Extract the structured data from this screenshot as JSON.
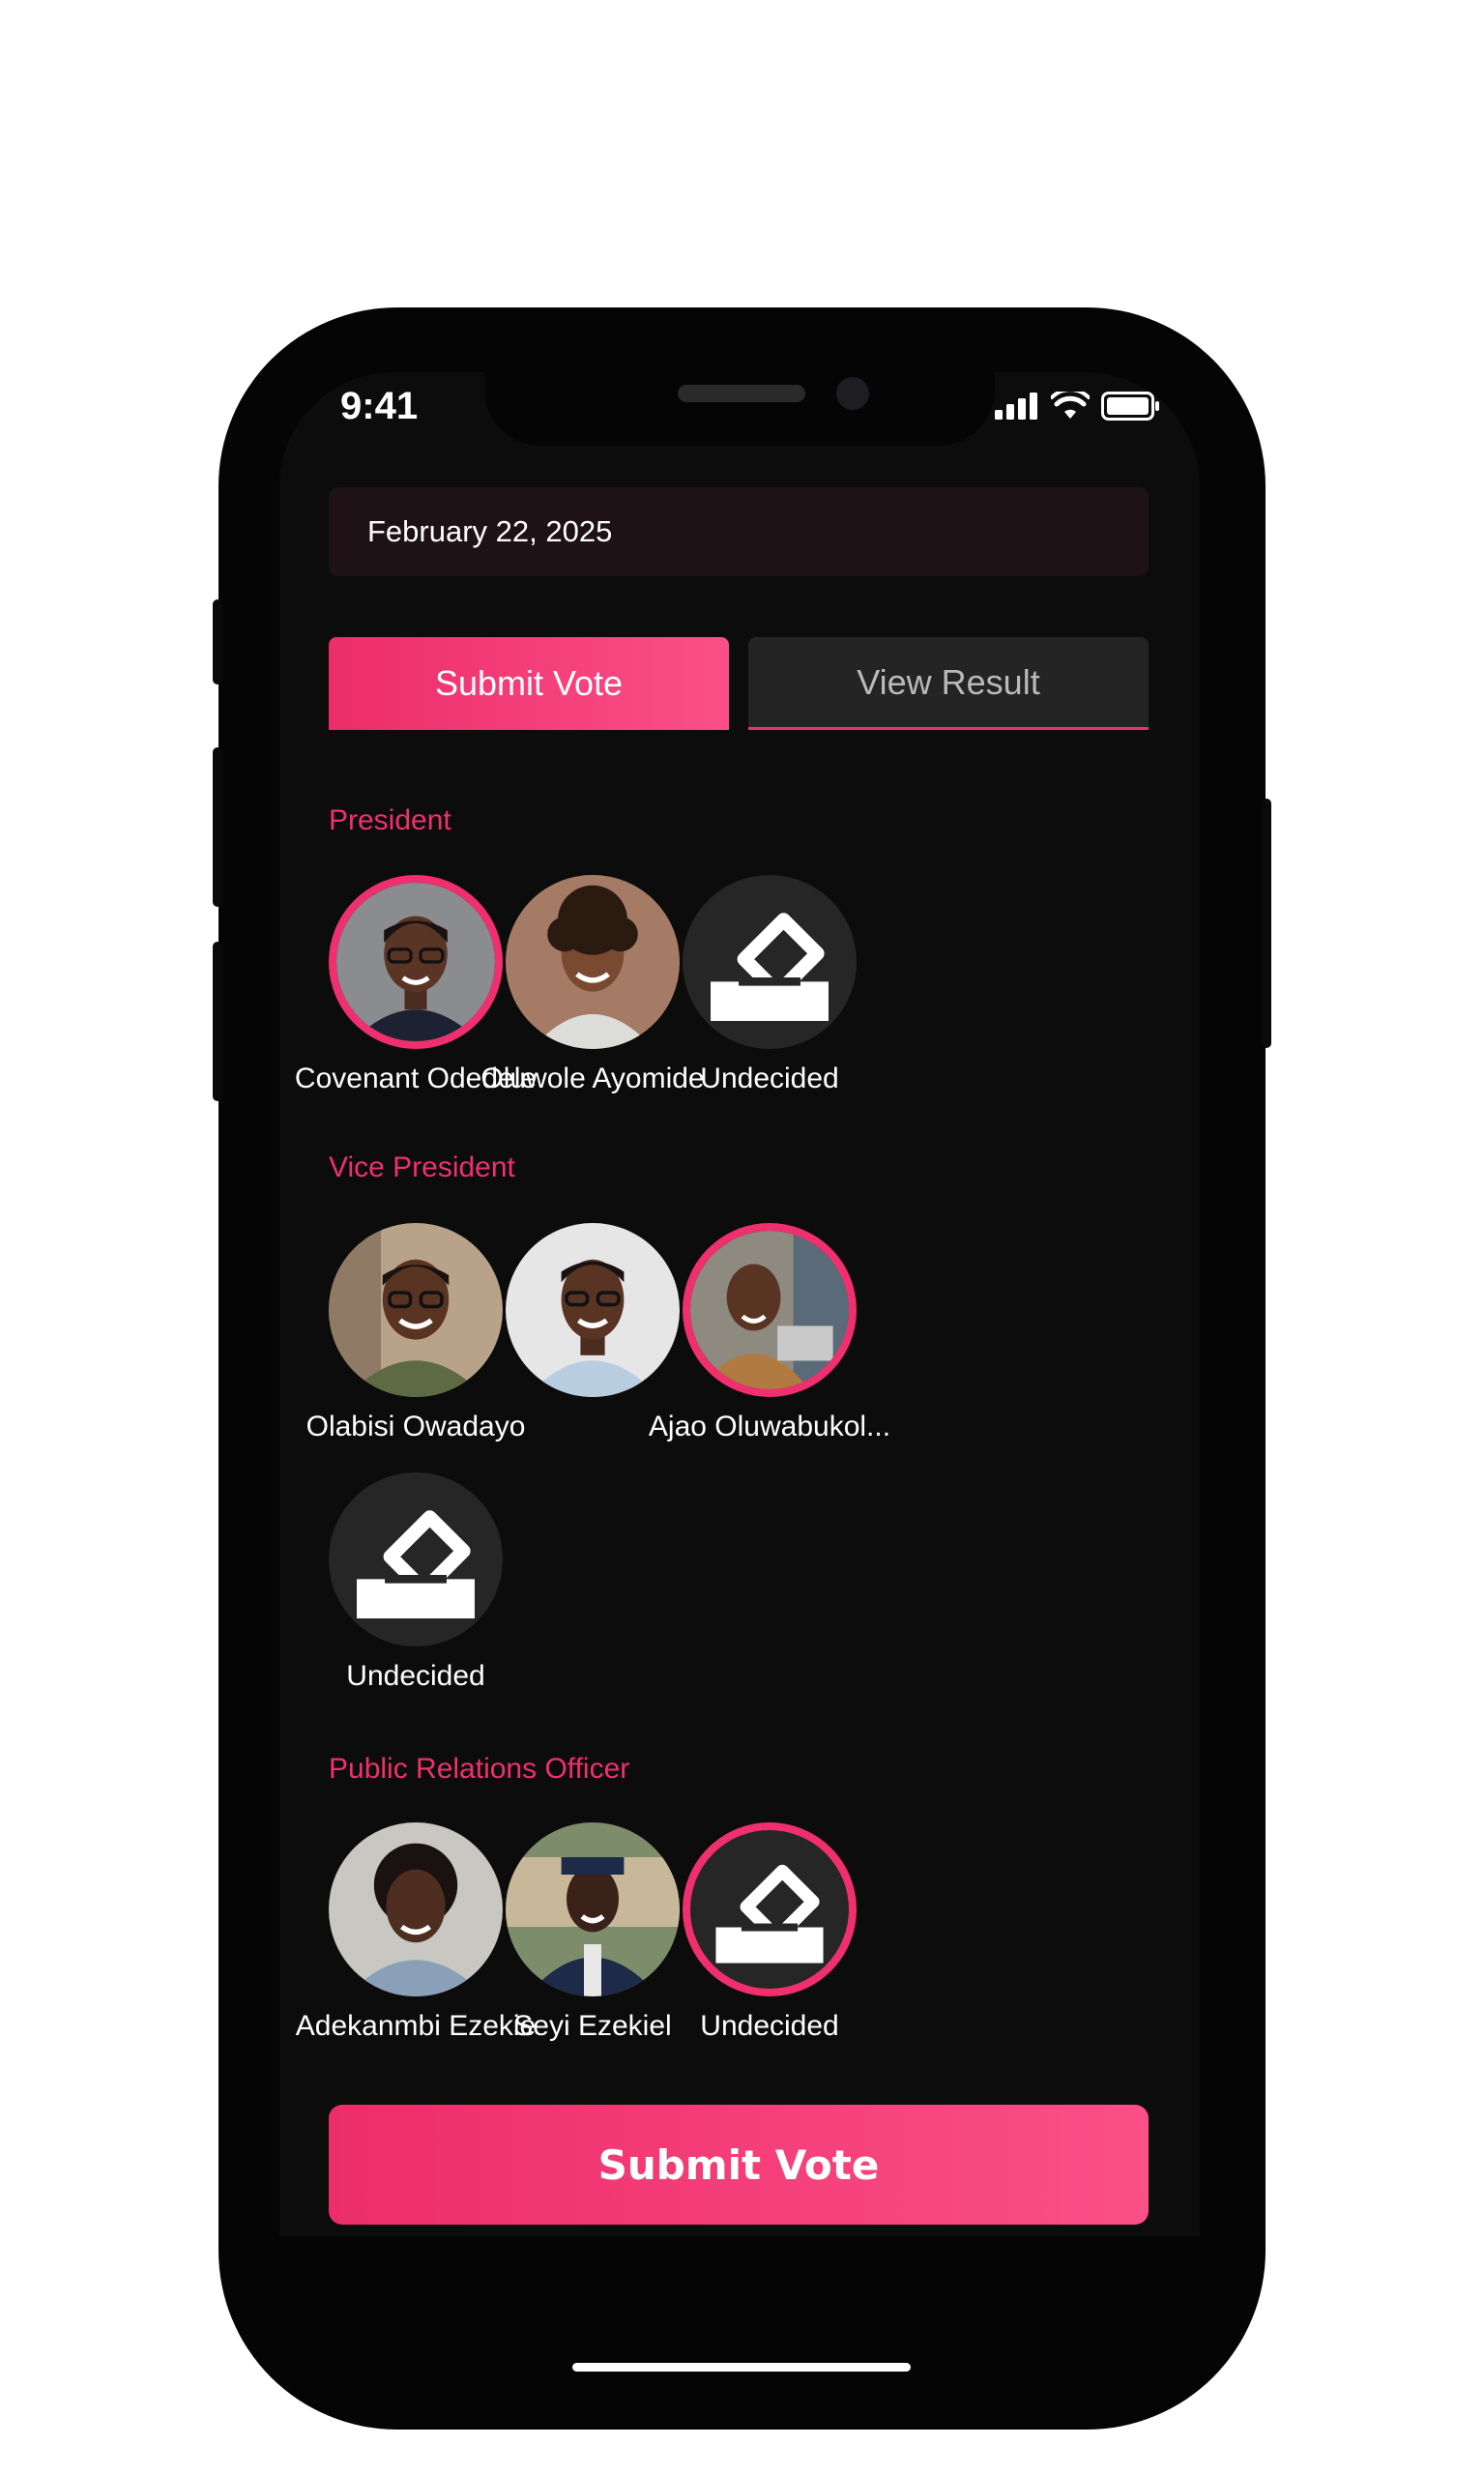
{
  "status_bar": {
    "time": "9:41"
  },
  "date_field": {
    "value": "February 22, 2025"
  },
  "tabs": [
    {
      "label": "Submit Vote",
      "active": true
    },
    {
      "label": "View Result",
      "active": false
    }
  ],
  "sections": [
    {
      "title": "President",
      "candidates": [
        {
          "name": "Covenant Odedele",
          "selected": true
        },
        {
          "name": "Oluwole Ayomide",
          "selected": false
        },
        {
          "name": "Undecided",
          "selected": false,
          "icon": "ballot-box-icon"
        }
      ]
    },
    {
      "title": "Vice President",
      "candidates": [
        {
          "name": "Olabisi Owadayo",
          "selected": false
        },
        {
          "name": "",
          "selected": false
        },
        {
          "name": "Ajao Oluwabukol...",
          "selected": true
        },
        {
          "name": "Undecided",
          "selected": false,
          "icon": "ballot-box-icon"
        }
      ]
    },
    {
      "title": "Public Relations Officer",
      "candidates": [
        {
          "name": "Adekanmbi Ezekie",
          "selected": false
        },
        {
          "name": "Seyi Ezekiel",
          "selected": false
        },
        {
          "name": "Undecided",
          "selected": true,
          "icon": "ballot-box-icon"
        }
      ]
    }
  ],
  "submit_button": {
    "label": "Submit Vote"
  },
  "colors": {
    "accent": "#f0306e",
    "background": "#0c0c0c",
    "surface": "#262626"
  }
}
